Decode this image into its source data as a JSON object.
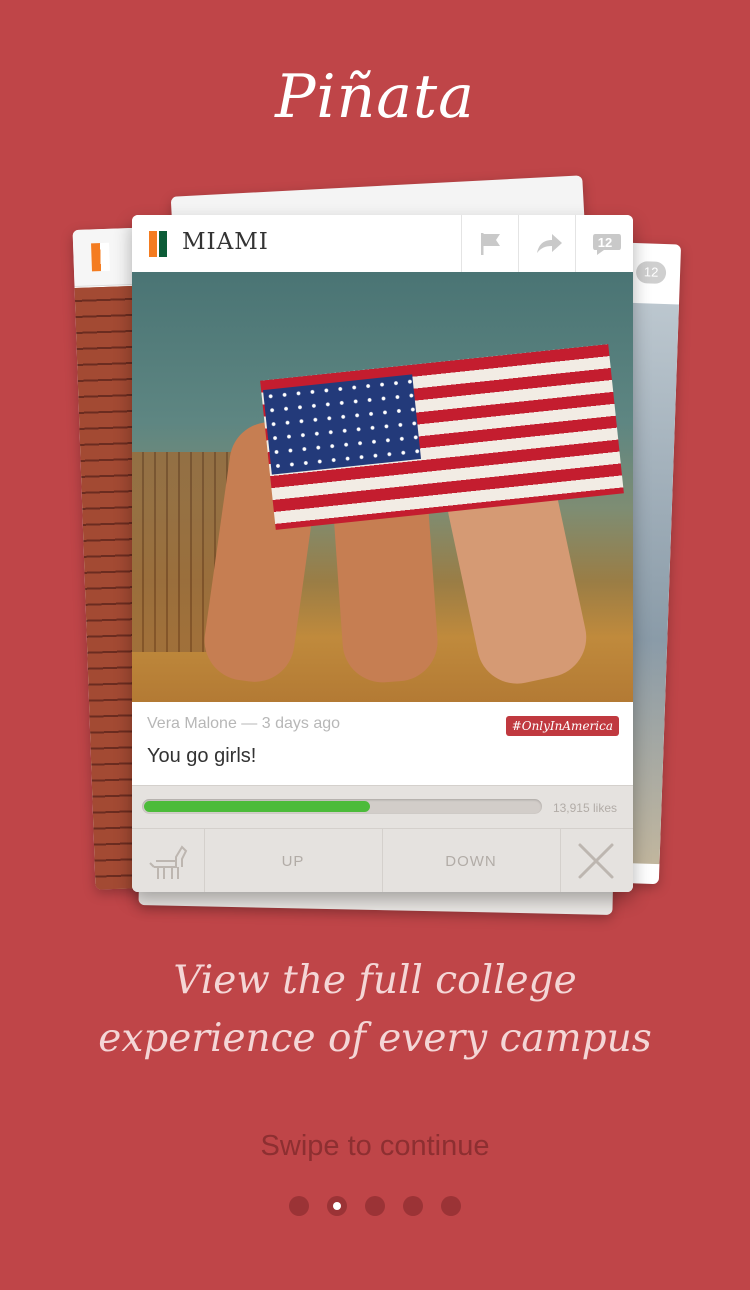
{
  "app": {
    "logo": "Piñata"
  },
  "post": {
    "school": "MIAMI",
    "school_colors": [
      "#f47c20",
      "#ffffff",
      "#0c5c37"
    ],
    "comment_count": "12",
    "author_time": "Vera Malone — 3 days ago",
    "hashtag": "#OnlyInAmerica",
    "caption": "You go girls!",
    "like_progress": 0.57,
    "likes_label": "13,915 likes",
    "actions": {
      "up": "UP",
      "down": "DOWN"
    }
  },
  "background_cards": {
    "comment_count": "12"
  },
  "tagline": {
    "line1": "View the full college",
    "line2": "experience of every campus"
  },
  "swipe_hint": "Swipe to continue",
  "pagination": {
    "total": 5,
    "active_index": 1
  },
  "colors": {
    "background": "#bf4548",
    "progress": "#4cbb3a",
    "tag": "#c0393f"
  }
}
